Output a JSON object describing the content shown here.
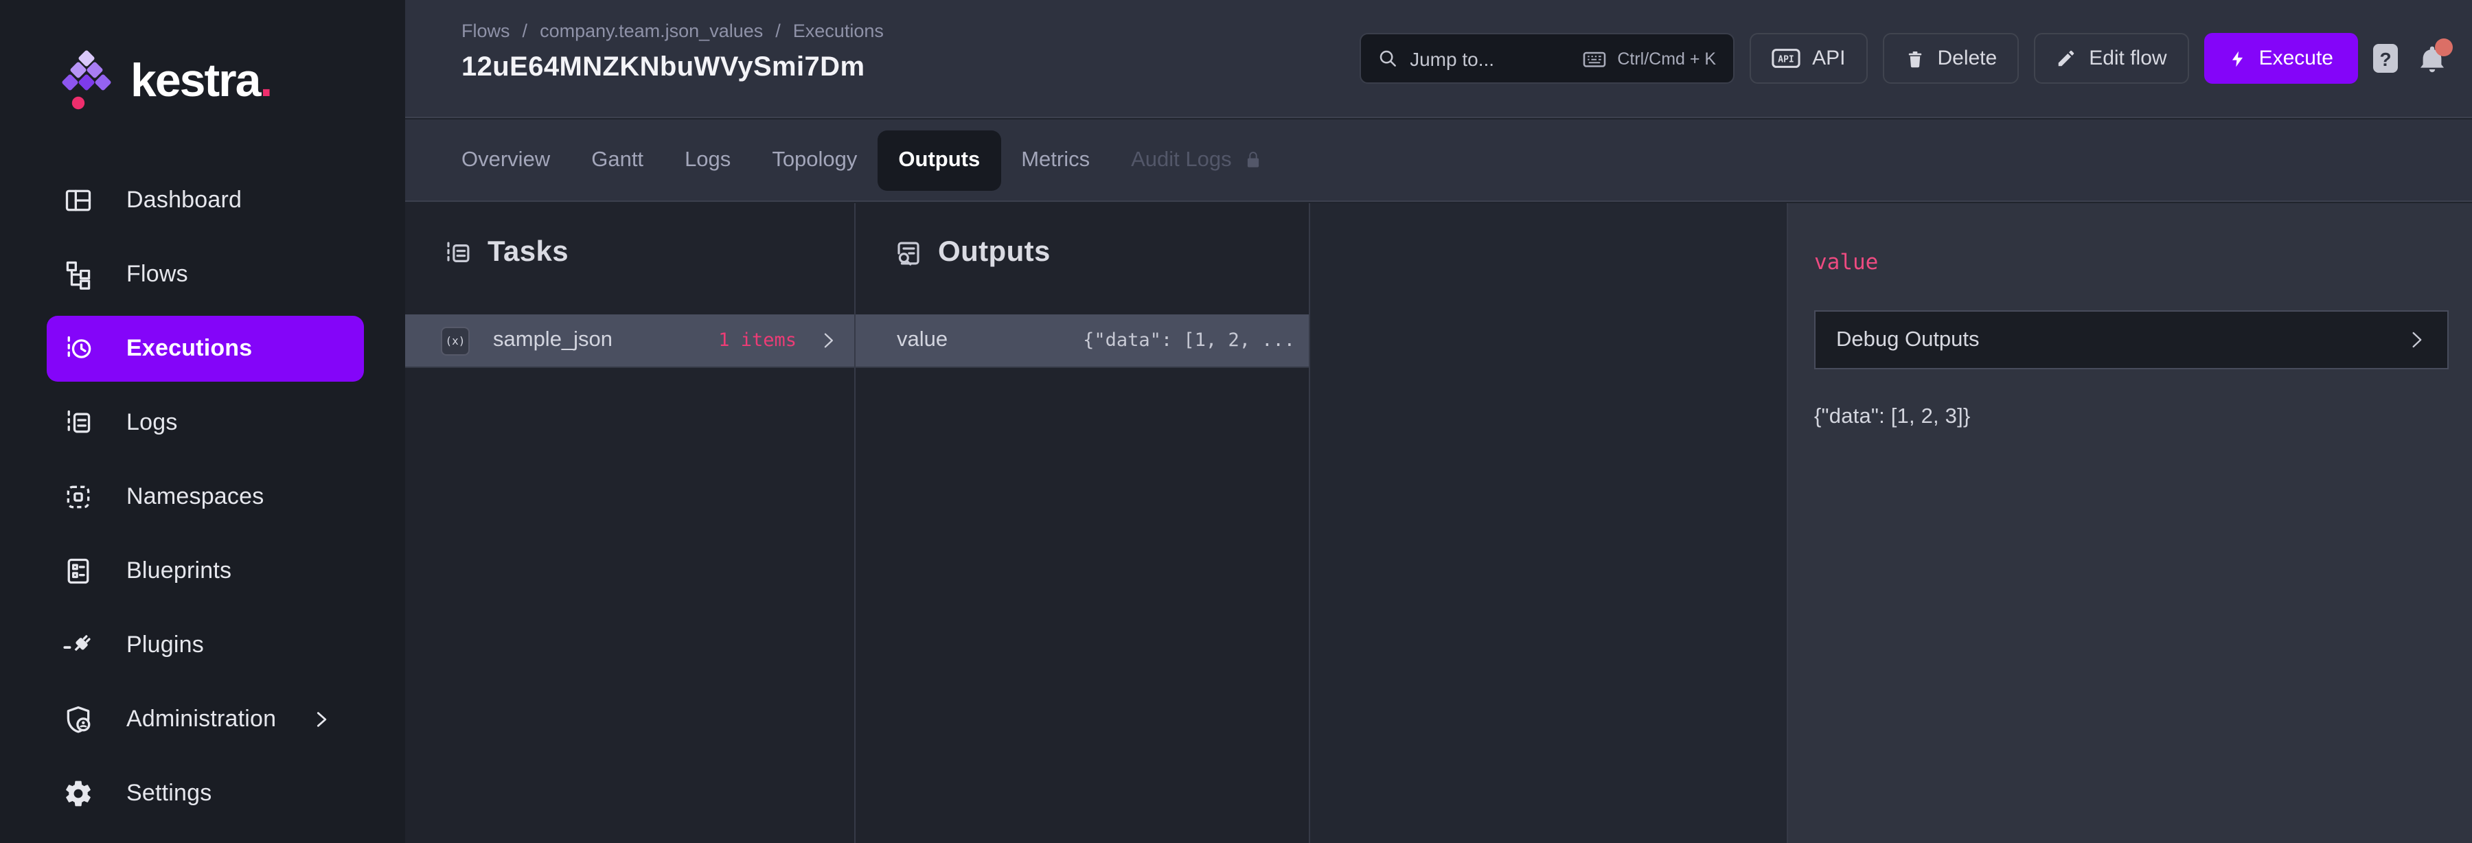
{
  "brand": {
    "wordmark": "kestra",
    "wordmark_suffix": "."
  },
  "sidebar": {
    "items": [
      {
        "label": "Dashboard",
        "icon": "dashboard-icon",
        "active": false
      },
      {
        "label": "Flows",
        "icon": "flows-icon",
        "active": false
      },
      {
        "label": "Executions",
        "icon": "executions-icon",
        "active": true
      },
      {
        "label": "Logs",
        "icon": "logs-icon",
        "active": false
      },
      {
        "label": "Namespaces",
        "icon": "namespaces-icon",
        "active": false
      },
      {
        "label": "Blueprints",
        "icon": "blueprints-icon",
        "active": false
      },
      {
        "label": "Plugins",
        "icon": "plugins-icon",
        "active": false
      },
      {
        "label": "Administration",
        "icon": "administration-icon",
        "active": false,
        "has_submenu": true
      },
      {
        "label": "Settings",
        "icon": "settings-icon",
        "active": false
      }
    ]
  },
  "header": {
    "breadcrumb": {
      "items": [
        "Flows",
        "company.team.json_values",
        "Executions"
      ],
      "separator": "/"
    },
    "title": "12uE64MNZKNbuWVySmi7Dm",
    "search": {
      "placeholder": "Jump to...",
      "shortcut": "Ctrl/Cmd + K"
    },
    "actions": {
      "api_chip": "API",
      "api": "API",
      "delete": "Delete",
      "edit_flow": "Edit flow",
      "execute": "Execute",
      "help": "?"
    }
  },
  "tabs": {
    "items": [
      {
        "label": "Overview",
        "state": "normal"
      },
      {
        "label": "Gantt",
        "state": "normal"
      },
      {
        "label": "Logs",
        "state": "normal"
      },
      {
        "label": "Topology",
        "state": "normal"
      },
      {
        "label": "Outputs",
        "state": "active"
      },
      {
        "label": "Metrics",
        "state": "normal"
      },
      {
        "label": "Audit Logs",
        "state": "locked"
      }
    ]
  },
  "outputs_view": {
    "tasks_panel": {
      "title": "Tasks",
      "rows": [
        {
          "icon_text": "(x)",
          "name": "sample_json",
          "count": "1 items"
        }
      ]
    },
    "outputs_panel": {
      "title": "Outputs",
      "rows": [
        {
          "key": "value",
          "preview": "{\"data\": [1, 2, ..."
        }
      ]
    },
    "detail_panel": {
      "key": "value",
      "debug_label": "Debug Outputs",
      "value_json": "{\"data\": [1, 2, 3]}"
    }
  },
  "colors": {
    "accent_purple": "#8405F9",
    "accent_pink": "#ED3C76",
    "value_pink": "#EE4B81",
    "notification_dot": "#DB6F66",
    "sidebar_bg": "#1A1D24",
    "header_bg": "#2E323F",
    "panel_bg": "#303440",
    "column_bg": "#20232C",
    "selected_row_bg": "#4A4F60"
  }
}
